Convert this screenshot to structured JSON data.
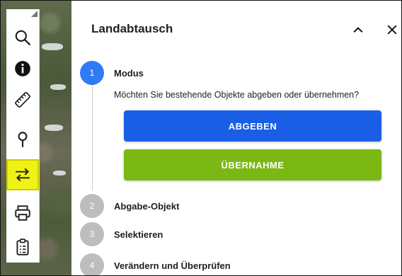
{
  "panel": {
    "title": "Landabtausch",
    "collapse_icon": "chevron-up-icon",
    "close_icon": "close-icon"
  },
  "toolbar": {
    "items": [
      {
        "icon": "search-icon"
      },
      {
        "icon": "info-icon"
      },
      {
        "icon": "ruler-icon"
      },
      {
        "icon": "pin-icon"
      },
      {
        "icon": "swap-arrows-icon",
        "active": true
      },
      {
        "icon": "printer-icon"
      },
      {
        "icon": "clipboard-list-icon"
      }
    ],
    "active_highlight": "#f0f216"
  },
  "steps": [
    {
      "number": "1",
      "label": "Modus",
      "state": "active"
    },
    {
      "number": "2",
      "label": "Abgabe-Objekt",
      "state": "inactive"
    },
    {
      "number": "3",
      "label": "Selektieren",
      "state": "inactive"
    },
    {
      "number": "4",
      "label": "Verändern und Überprüfen",
      "state": "inactive"
    }
  ],
  "modus": {
    "question": "Möchten Sie bestehende Objekte abgeben oder übernehmen?",
    "abgeben_label": "ABGEBEN",
    "uebernahme_label": "ÜBERNAHME"
  },
  "colors": {
    "step_active": "#2f7bf5",
    "step_inactive": "#bdbdbd",
    "abgeben_button": "#1a5ee6",
    "uebernahme_button": "#7cb814"
  }
}
